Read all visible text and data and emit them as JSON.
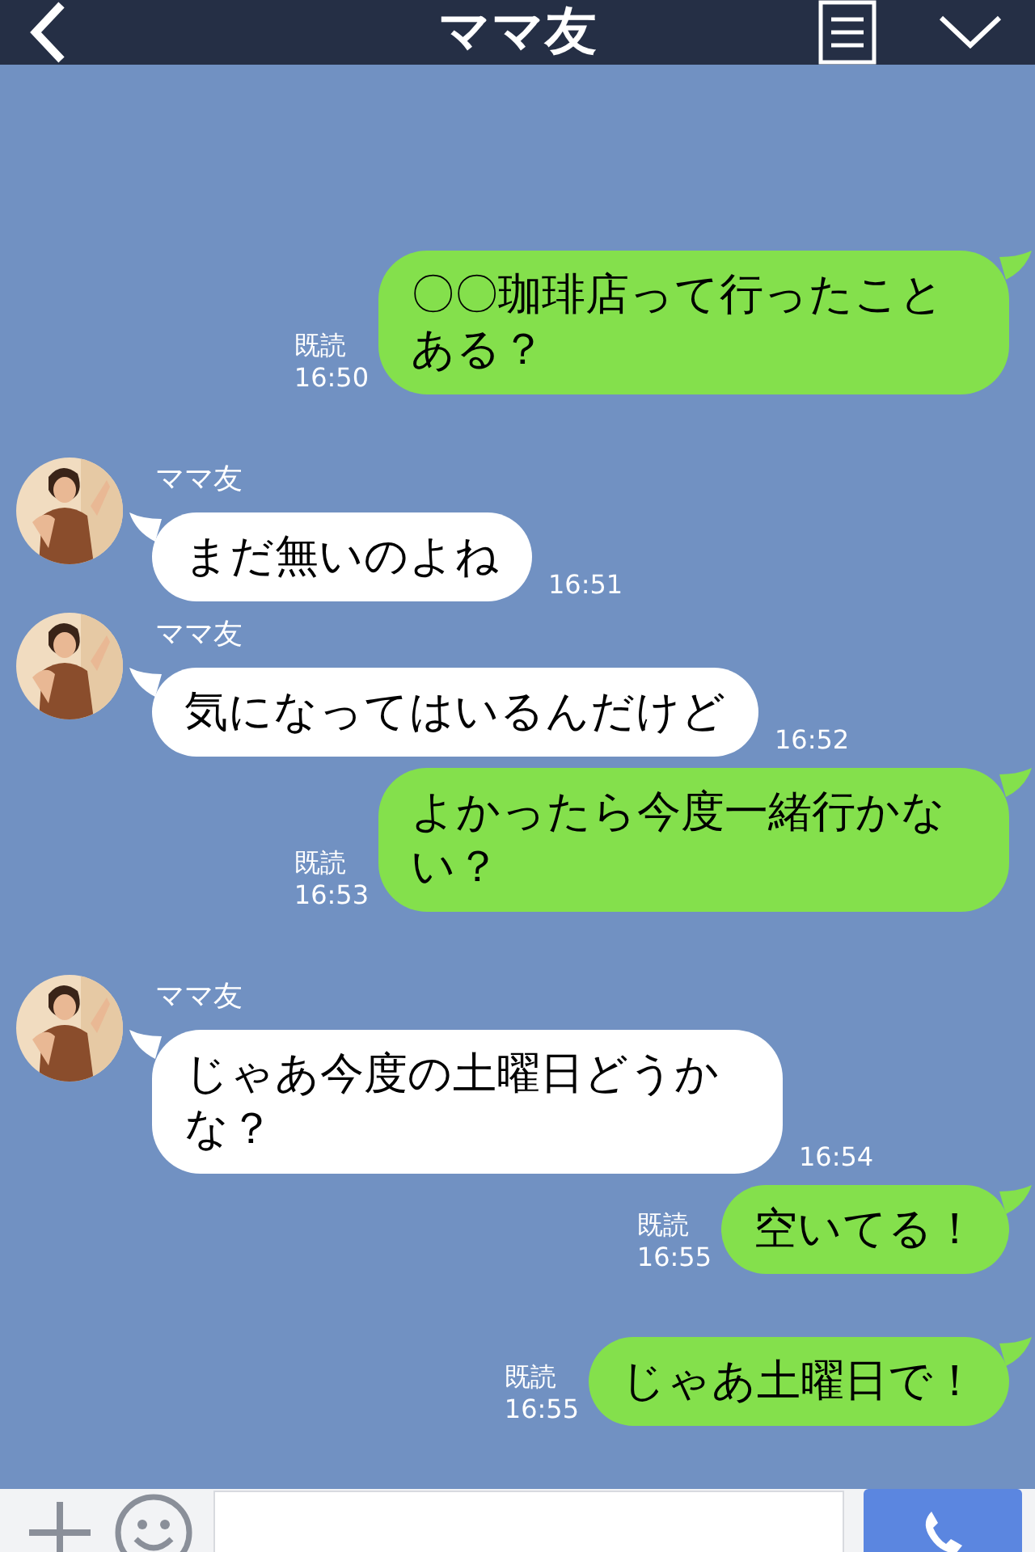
{
  "header": {
    "title": "ママ友"
  },
  "messages": [
    {
      "kind": "sent",
      "text": "〇〇珈琲店って行ったことある？",
      "read": "既読",
      "time": "16:50"
    },
    {
      "kind": "received",
      "sender": "ママ友",
      "text": "まだ無いのよね",
      "time": "16:51"
    },
    {
      "kind": "received",
      "sender": "ママ友",
      "text": "気になってはいるんだけど",
      "time": "16:52"
    },
    {
      "kind": "sent",
      "text": "よかったら今度一緒行かない？",
      "read": "既読",
      "time": "16:53"
    },
    {
      "kind": "received",
      "sender": "ママ友",
      "text": "じゃあ今度の土曜日どうかな？",
      "time": "16:54"
    },
    {
      "kind": "sent",
      "text": "空いてる！",
      "read": "既読",
      "time": "16:55"
    },
    {
      "kind": "sent",
      "text": "じゃあ土曜日で！",
      "read": "既読",
      "time": "16:55"
    }
  ]
}
